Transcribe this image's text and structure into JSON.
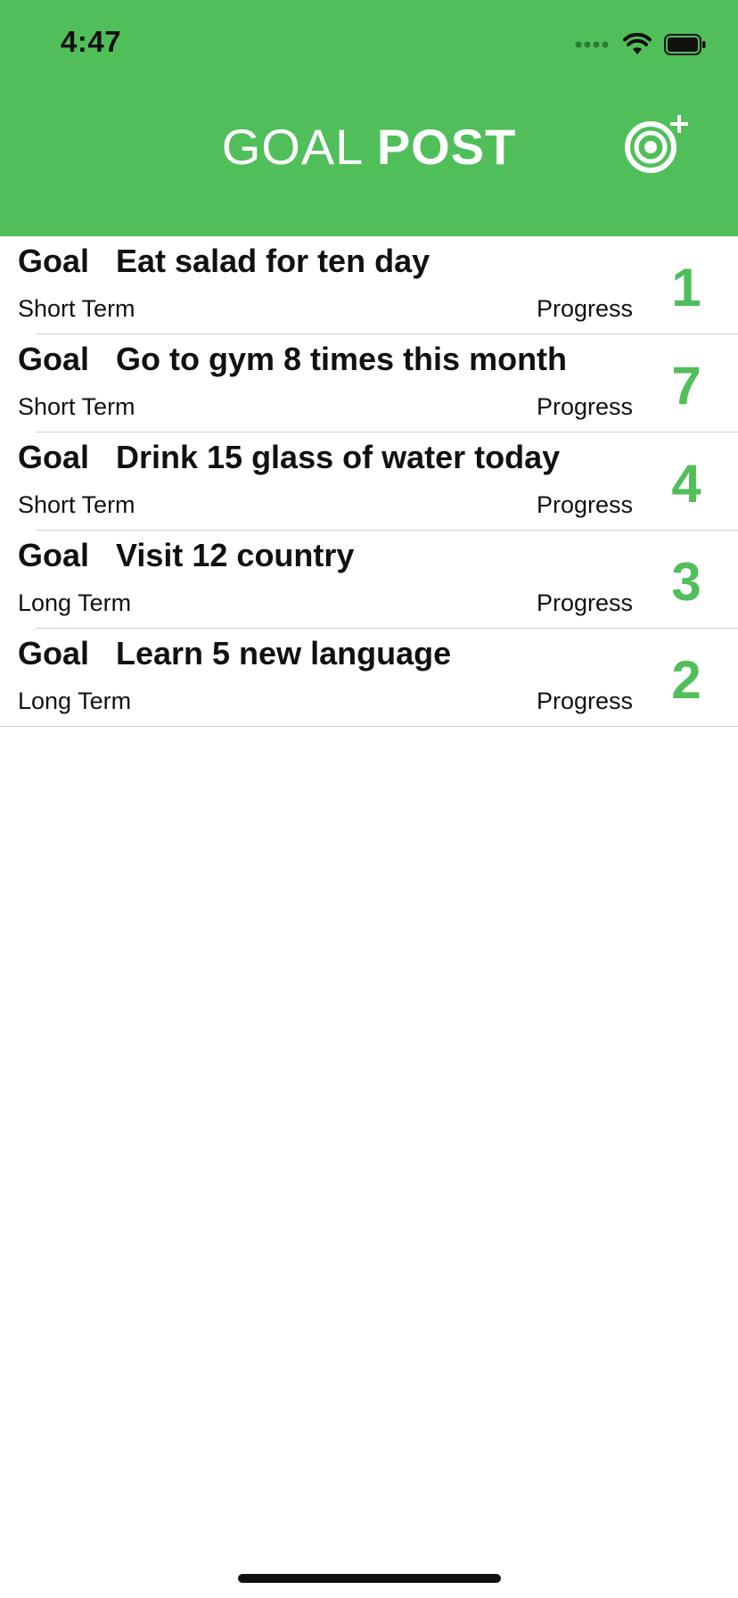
{
  "status_bar": {
    "time": "4:47"
  },
  "header": {
    "title_light": "GOAL",
    "title_bold": "POST",
    "add_icon": "target-plus-icon"
  },
  "goals": [
    {
      "label": "Goal",
      "description": "Eat salad for ten day",
      "type": "Short Term",
      "progress_label": "Progress",
      "progress": "1"
    },
    {
      "label": "Goal",
      "description": "Go to gym 8 times this month",
      "type": "Short Term",
      "progress_label": "Progress",
      "progress": "7"
    },
    {
      "label": "Goal",
      "description": "Drink 15 glass of water today",
      "type": "Short Term",
      "progress_label": "Progress",
      "progress": "4"
    },
    {
      "label": "Goal",
      "description": "Visit 12 country",
      "type": "Long Term",
      "progress_label": "Progress",
      "progress": "3"
    },
    {
      "label": "Goal",
      "description": "Learn 5 new language",
      "type": "Long Term",
      "progress_label": "Progress",
      "progress": "2"
    }
  ],
  "colors": {
    "accent": "#50bf5a",
    "text": "#111111",
    "divider": "#cfcfcf"
  }
}
